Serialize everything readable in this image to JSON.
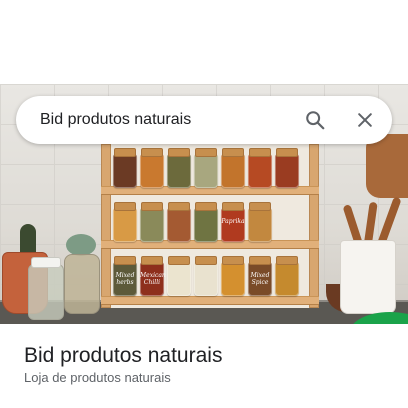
{
  "search": {
    "query": "Bid produtos naturais"
  },
  "icons": {
    "search": "search-icon",
    "close": "close-icon"
  },
  "result": {
    "title": "Bid produtos naturais",
    "subtitle": "Loja de produtos naturais"
  },
  "photo": {
    "jars": {
      "row1": [
        {
          "label": "",
          "color": "#6b3a24"
        },
        {
          "label": "",
          "color": "#c9792f"
        },
        {
          "label": "",
          "color": "#6c6a3c"
        },
        {
          "label": "",
          "color": "#a8a77f"
        },
        {
          "label": "",
          "color": "#c2742c"
        },
        {
          "label": "",
          "color": "#b64a23"
        },
        {
          "label": "",
          "color": "#9a3c21"
        }
      ],
      "row2": [
        {
          "label": "",
          "color": "#d89a45"
        },
        {
          "label": "",
          "color": "#8a8a5a"
        },
        {
          "label": "",
          "color": "#a45a32"
        },
        {
          "label": "",
          "color": "#6f7442"
        },
        {
          "label": "Paprika",
          "color": "#b03a1f"
        },
        {
          "label": "",
          "color": "#c2883f"
        }
      ],
      "row3": [
        {
          "label": "Mixed herbs",
          "color": "#5d5a3a"
        },
        {
          "label": "Mexican Chilli",
          "color": "#8e2f1c"
        },
        {
          "label": "",
          "color": "#ebe4cf"
        },
        {
          "label": "",
          "color": "#e9e2cf"
        },
        {
          "label": "",
          "color": "#d4902f"
        },
        {
          "label": "Mixed Spice",
          "color": "#7a4b28"
        },
        {
          "label": "",
          "color": "#c58a2e"
        }
      ]
    }
  }
}
